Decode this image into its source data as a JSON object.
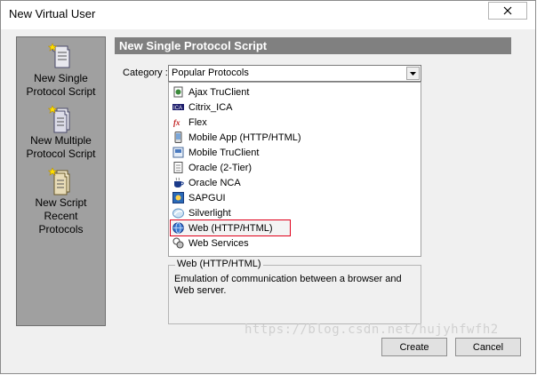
{
  "window": {
    "title": "New Virtual User"
  },
  "sidebar": {
    "items": [
      {
        "label_line1": "New Single",
        "label_line2": "Protocol Script"
      },
      {
        "label_line1": "New Multiple",
        "label_line2": "Protocol Script"
      },
      {
        "label_line1": "New Script",
        "label_line2": "Recent",
        "label_line3": "Protocols"
      }
    ]
  },
  "main": {
    "header": "New Single Protocol Script",
    "category_label": "Category :",
    "category_value": "Popular Protocols",
    "protocols": [
      {
        "label": "Ajax TruClient",
        "icon": "ajax-truclient-icon"
      },
      {
        "label": "Citrix_ICA",
        "icon": "citrix-icon"
      },
      {
        "label": "Flex",
        "icon": "flex-icon"
      },
      {
        "label": "Mobile App (HTTP/HTML)",
        "icon": "mobile-app-icon"
      },
      {
        "label": "Mobile TruClient",
        "icon": "mobile-truclient-icon"
      },
      {
        "label": "Oracle (2-Tier)",
        "icon": "oracle-2tier-icon"
      },
      {
        "label": "Oracle NCA",
        "icon": "oracle-nca-icon"
      },
      {
        "label": "SAPGUI",
        "icon": "sapgui-icon"
      },
      {
        "label": "Silverlight",
        "icon": "silverlight-icon"
      },
      {
        "label": "Web (HTTP/HTML)",
        "icon": "web-http-icon",
        "selected": true
      },
      {
        "label": "Web Services",
        "icon": "web-services-icon"
      }
    ],
    "description": {
      "title": "Web (HTTP/HTML)",
      "text": "Emulation of communication between a browser and Web server."
    }
  },
  "buttons": {
    "create": "Create",
    "cancel": "Cancel"
  },
  "watermark": "https://blog.csdn.net/hujyhfwfh2",
  "colors": {
    "header_bg": "#808080",
    "sidebar_bg": "#a0a0a0",
    "selection_outline": "#e0001a"
  }
}
